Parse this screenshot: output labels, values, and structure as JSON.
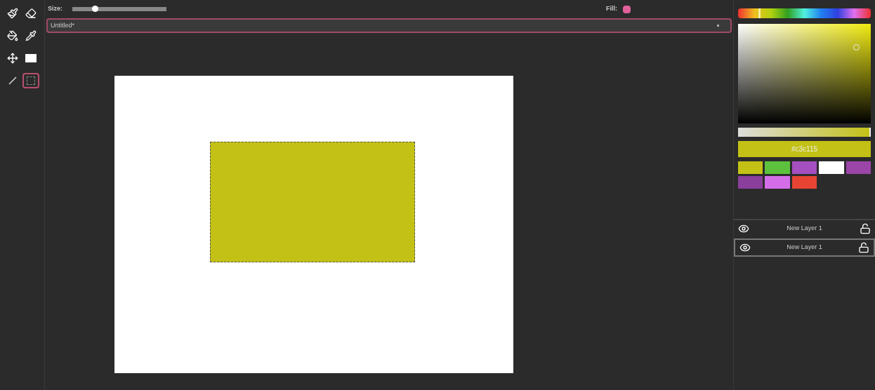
{
  "tools": [
    {
      "kind": "brush",
      "selected": false
    },
    {
      "kind": "eraser",
      "selected": false
    },
    {
      "kind": "fill",
      "selected": false
    },
    {
      "kind": "picker",
      "selected": false
    },
    {
      "kind": "move",
      "selected": false
    },
    {
      "kind": "rectangle",
      "selected": false
    },
    {
      "kind": "line",
      "selected": false
    },
    {
      "kind": "select",
      "selected": true
    }
  ],
  "size": {
    "label": "Size:",
    "level": 0.24
  },
  "fill": {
    "label": "Fill:",
    "color": "#e0609a"
  },
  "document": {
    "title": "Untitled*"
  },
  "canvas": {
    "shapes": [
      {
        "kind": "rectangle",
        "color": "#c3c115",
        "selected": true
      }
    ]
  },
  "color_picker": {
    "hex": "#c3c115",
    "hue": {
      "level": 0.16
    },
    "alpha": {
      "level": 1
    }
  },
  "swatches": [
    {
      "color": "#c3c115"
    },
    {
      "color": "#5cc23d"
    },
    {
      "color": "#a64fc0"
    },
    {
      "color": "#ffffff"
    },
    {
      "color": "#9b45a8"
    },
    {
      "color": "#8a3f9c"
    },
    {
      "color": "#d46ee8"
    },
    {
      "color": "#e84433"
    }
  ],
  "layers": [
    {
      "name": "New Layer 1",
      "visible": true,
      "locked": false,
      "selected": false
    },
    {
      "name": "New Layer 1",
      "visible": true,
      "locked": false,
      "selected": true
    }
  ]
}
